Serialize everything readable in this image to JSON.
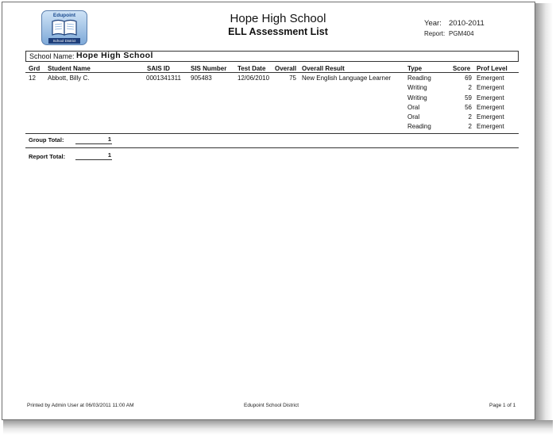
{
  "header": {
    "logo_text": "Edupoint",
    "logo_subtext": "School District",
    "school_title": "Hope High School",
    "report_title": "ELL Assessment List",
    "year_label": "Year:",
    "year_value": "2010-2011",
    "report_label": "Report:",
    "report_value": "PGM404"
  },
  "school_box": {
    "label": "School Name:",
    "value": "Hope High School"
  },
  "columns": {
    "grd": "Grd",
    "student_name": "Student Name",
    "sais_id": "SAIS ID",
    "sis_number": "SIS Number",
    "test_date": "Test Date",
    "overall": "Overall",
    "overall_result": "Overall Result",
    "type": "Type",
    "score": "Score",
    "prof_level": "Prof Level"
  },
  "record": {
    "grd": "12",
    "student_name": "Abbott, Billy C.",
    "sais_id": "0001341311",
    "sis_number": "905483",
    "test_date": "12/06/2010",
    "overall": "75",
    "overall_result": "New English Language Learner",
    "assessments": [
      {
        "type": "Reading",
        "score": "69",
        "prof_level": "Emergent"
      },
      {
        "type": "Writing",
        "score": "2",
        "prof_level": "Emergent"
      },
      {
        "type": "Writing",
        "score": "59",
        "prof_level": "Emergent"
      },
      {
        "type": "Oral",
        "score": "56",
        "prof_level": "Emergent"
      },
      {
        "type": "Oral",
        "score": "2",
        "prof_level": "Emergent"
      },
      {
        "type": "Reading",
        "score": "2",
        "prof_level": "Emergent"
      }
    ]
  },
  "totals": {
    "group_label": "Group Total:",
    "group_value": "1",
    "report_label": "Report Total:",
    "report_value": "1"
  },
  "footer": {
    "printed_by": "Printed by Admin User at 06/03/2011 11:00 AM",
    "district": "Edupoint School District",
    "page": "Page 1 of 1"
  }
}
